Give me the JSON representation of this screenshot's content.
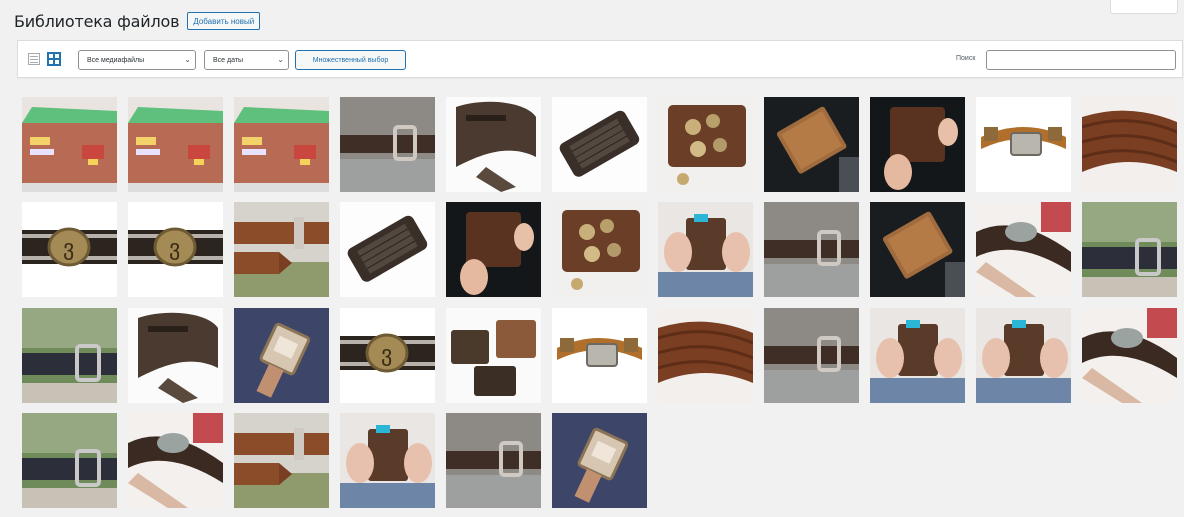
{
  "header": {
    "title": "Библиотека файлов",
    "add_new_label": "Добавить новый"
  },
  "toolbar": {
    "media_type_selected": "Все медиафайлы",
    "date_selected": "Все даты",
    "bulk_select_label": "Множественный выбор",
    "search_label": "Поиск",
    "search_value": ""
  },
  "items": [
    "store",
    "store",
    "store",
    "belt",
    "belt-white",
    "belt-rolled",
    "wallet-coins",
    "wallet-dark",
    "wallet-hands",
    "bracelet-silver",
    "belt-braided",
    "bracelet-zodiac",
    "bracelet-zodiac",
    "belt-grass",
    "belt-rolled",
    "wallet-hands",
    "wallet-coins",
    "wallet-blue",
    "belt",
    "wallet-dark",
    "bracelet-wrist",
    "belt-green",
    "belt-green",
    "belt-white",
    "bracelet-navy",
    "bracelet-zodiac",
    "wallets-pair",
    "bracelet-silver",
    "belt-braided",
    "belt",
    "wallet-blue",
    "wallet-blue",
    "bracelet-wrist",
    "belt-green",
    "bracelet-wrist",
    "belt-grass",
    "wallet-blue",
    "belt",
    "bracelet-navy"
  ]
}
